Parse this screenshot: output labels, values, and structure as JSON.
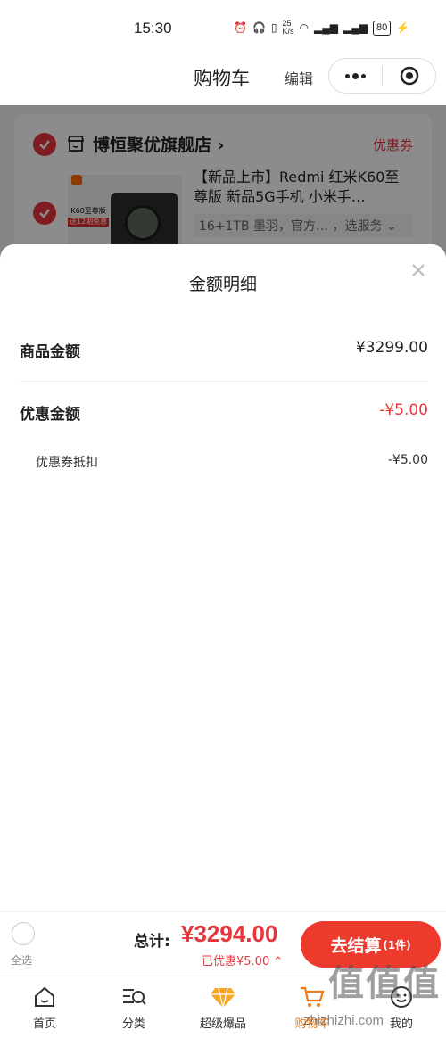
{
  "status_bar": {
    "time": "15:30",
    "net_speed": "25\nK/s",
    "battery": "80"
  },
  "nav": {
    "title": "购物车",
    "edit": "编辑"
  },
  "cart": {
    "shop_name": "博恒聚优旗舰店",
    "coupon_link": "优惠券",
    "product_title": "【新品上市】Redmi 红米K60至尊版 新品5G手机 小米手…",
    "product_spec": "16+1TB 墨羽，官方… ，选服务",
    "promo_text_1": "K60至尊版",
    "promo_text_2": "送12期免息"
  },
  "sheet": {
    "title": "金额明细",
    "goods_label": "商品金额",
    "goods_value": "¥3299.00",
    "discount_label": "优惠金额",
    "discount_value": "-¥5.00",
    "coupon_label": "优惠券抵扣",
    "coupon_value": "-¥5.00"
  },
  "checkout": {
    "select_all": "全选",
    "total_label": "总计:",
    "total_amount": "¥3294.00",
    "saved": "已优惠¥5.00",
    "button_label": "去结算",
    "button_count": "(1件)"
  },
  "tabs": [
    {
      "label": "首页",
      "icon": "home-icon"
    },
    {
      "label": "分类",
      "icon": "category-search-icon"
    },
    {
      "label": "超级爆品",
      "icon": "diamond-icon"
    },
    {
      "label": "购物车",
      "icon": "cart-icon"
    },
    {
      "label": "我的",
      "icon": "profile-icon"
    }
  ],
  "colors": {
    "accent_red": "#e8343c",
    "active_tab": "#f07a14",
    "diamond": "#f5a623"
  },
  "watermark": {
    "text": "值值值",
    "url": "zhizhizhi.com"
  }
}
